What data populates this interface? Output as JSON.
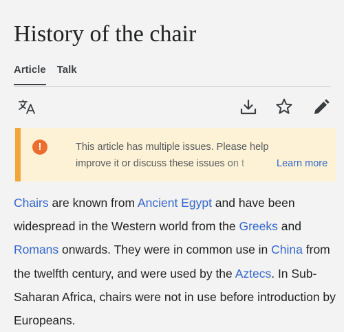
{
  "page": {
    "title": "History of the chair"
  },
  "tabs": [
    {
      "label": "Article",
      "active": true
    },
    {
      "label": "Talk",
      "active": false
    }
  ],
  "toolbar": {
    "icons": [
      "translate-icon",
      "download-icon",
      "star-icon",
      "edit-pencil-icon"
    ]
  },
  "banner": {
    "icon": "!",
    "line1": "This article has multiple issues. Please help",
    "line2": "improve it or discuss these issues on t",
    "learn_more": "Learn more"
  },
  "article": {
    "segments": [
      {
        "text": "Chairs",
        "link": true
      },
      {
        "text": " are known from ",
        "link": false
      },
      {
        "text": "Ancient Egypt",
        "link": true
      },
      {
        "text": " and have been widespread in the Western world from the ",
        "link": false
      },
      {
        "text": "Greeks",
        "link": true
      },
      {
        "text": " and ",
        "link": false
      },
      {
        "text": "Romans",
        "link": true
      },
      {
        "text": " onwards. They were in common use in ",
        "link": false
      },
      {
        "text": "China",
        "link": true
      },
      {
        "text": " from the twelfth century, and were used by the ",
        "link": false
      },
      {
        "text": "Aztecs",
        "link": true
      },
      {
        "text": ". In Sub-Saharan Africa, chairs were not in use before introduction by Europeans.",
        "link": false
      }
    ]
  },
  "colors": {
    "link": "#3366cc",
    "banner_bg": "#fdf2d5",
    "banner_border": "#f3a638",
    "warning": "#ed6d2e",
    "text": "#202122"
  }
}
